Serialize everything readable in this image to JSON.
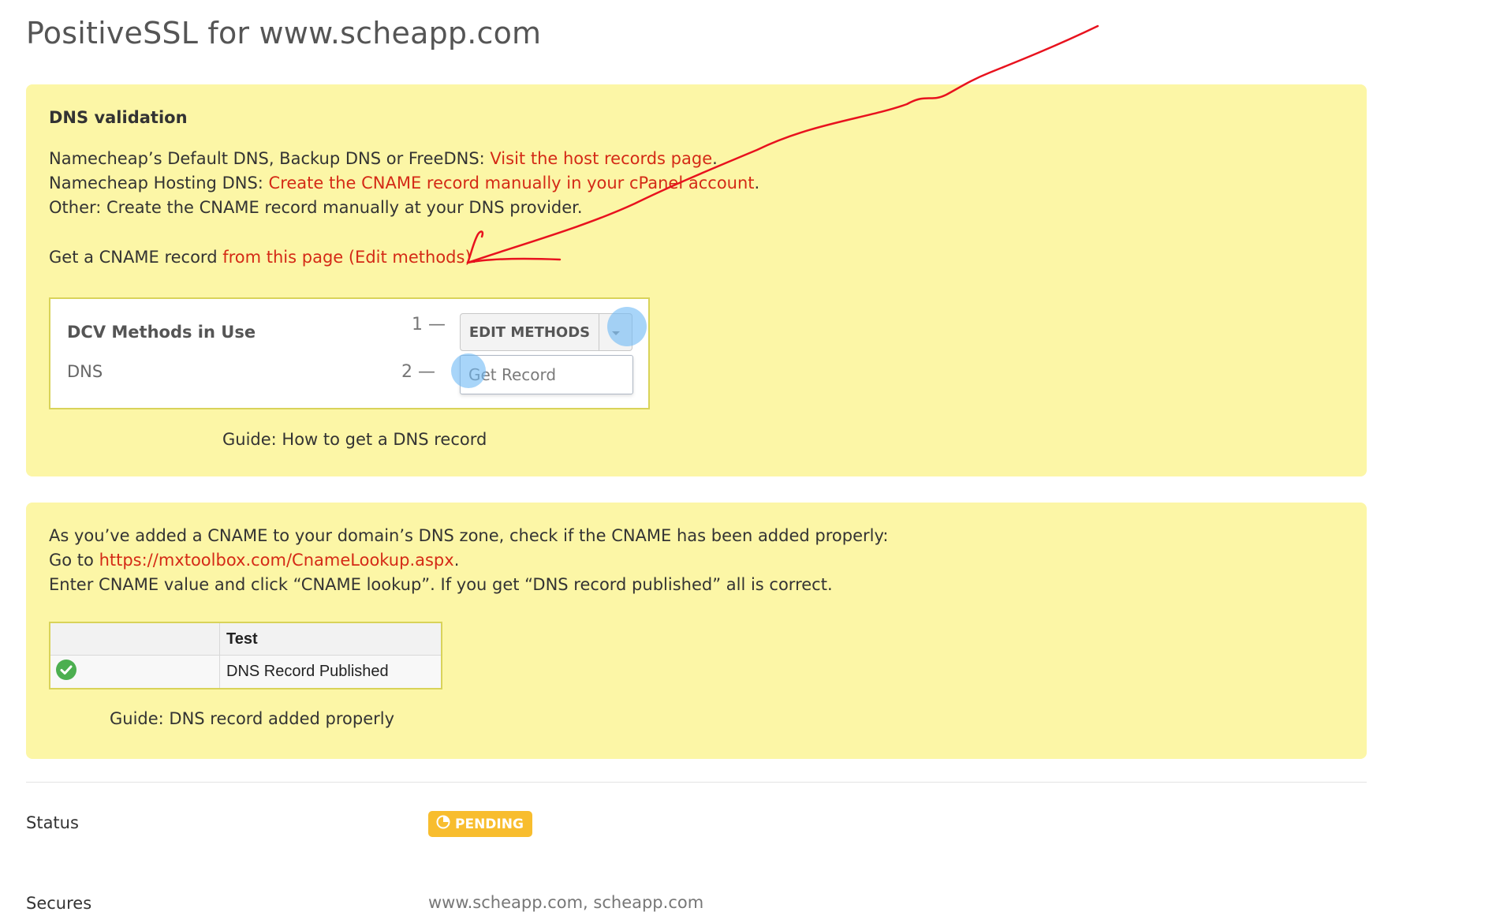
{
  "page": {
    "title": "PositiveSSL for www.scheapp.com"
  },
  "dns_box": {
    "heading": "DNS validation",
    "line1_prefix": "Namecheap’s Default DNS, Backup DNS or FreeDNS: ",
    "line1_link": "Visit the host records page",
    "line1_suffix": ".",
    "line2_prefix": "Namecheap Hosting DNS: ",
    "line2_link": "Create the CNAME record manually in your cPanel account",
    "line2_suffix": ".",
    "line3": "Other: Create the CNAME record manually at your DNS provider.",
    "line4_prefix": "Get a CNAME record ",
    "line4_link": "from this page (Edit methods)",
    "line4_suffix": ".",
    "dcv": {
      "title": "DCV Methods in Use",
      "method": "DNS",
      "step1": "1 —",
      "step2": "2 —",
      "edit_button": "EDIT METHODS",
      "menu_item": "Get Record"
    },
    "guide": "Guide: How to get a DNS record"
  },
  "check_box": {
    "line1": "As you’ve added a CNAME to your domain’s DNS zone, check if the CNAME has been added properly:",
    "line2_prefix": "Go to ",
    "line2_link": "https://mxtoolbox.com/CnameLookup.aspx",
    "line2_suffix": ".",
    "line3": "Enter CNAME value and click “CNAME lookup”. If you get “DNS record published” all is correct.",
    "table": {
      "header": "Test",
      "row_value": "DNS Record Published"
    },
    "guide": "Guide: DNS record added properly"
  },
  "details": {
    "status_label": "Status",
    "status_badge": "PENDING",
    "secures_label": "Secures",
    "secures_value": "www.scheapp.com, scheapp.com"
  },
  "colors": {
    "link": "#d42a16",
    "highlight_box": "#fcf6a6",
    "badge_pending": "#f8bd2e",
    "success": "#4caf50",
    "annotation_arrow": "#e8121e",
    "click_marker": "#6eb9f5"
  },
  "icons": {
    "caret": "chevron-down-icon",
    "success": "check-circle-icon",
    "pending": "clock-icon"
  }
}
